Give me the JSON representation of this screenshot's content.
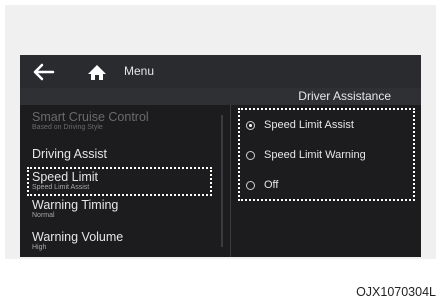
{
  "topbar": {
    "icons": [
      "back-arrow-icon",
      "home-icon"
    ],
    "menu_label": "Menu"
  },
  "section_title": "Driver Assistance",
  "left_menu": [
    {
      "title": "Smart Cruise Control",
      "sub": "Based on Driving Style",
      "disabled": true
    },
    {
      "title": "Driving Assist",
      "sub": "",
      "disabled": false
    },
    {
      "title": "Speed Limit",
      "sub": "Speed Limit Assist",
      "selected": true
    },
    {
      "title": "Warning Timing",
      "sub": "Normal",
      "disabled": false
    },
    {
      "title": "Warning Volume",
      "sub": "High",
      "disabled": false
    }
  ],
  "options": [
    {
      "label": "Speed Limit Assist",
      "checked": true
    },
    {
      "label": "Speed Limit Warning",
      "checked": false
    },
    {
      "label": "Off",
      "checked": false
    }
  ],
  "caption": "OJX1070304L",
  "colors": {
    "screen_bg": "#1c1c1f",
    "topbar_bg": "#2a2b2f",
    "text": "#e6e6e6",
    "dim_text": "#6a6a6a",
    "highlight": "#ffffff"
  }
}
